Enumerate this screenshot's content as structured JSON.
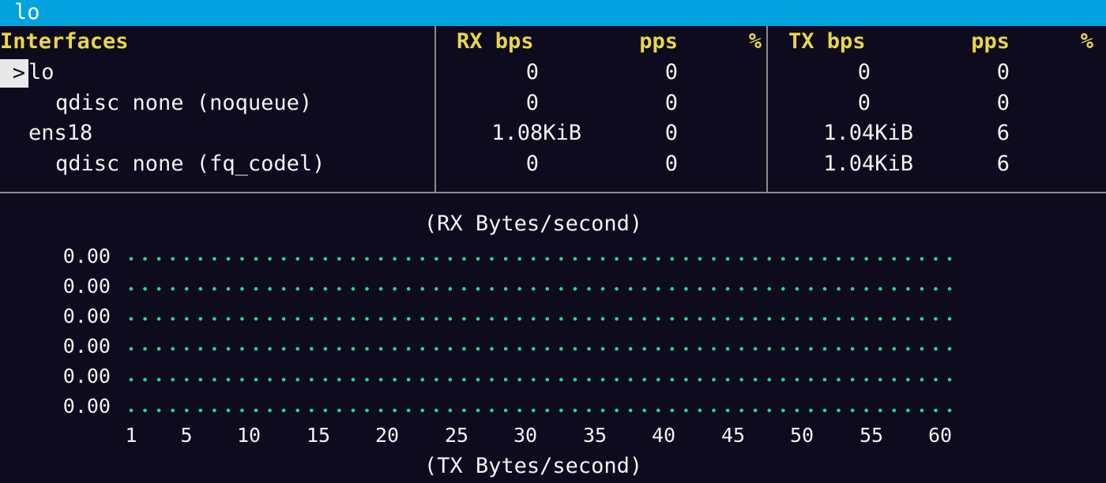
{
  "window": {
    "title": "lo"
  },
  "table": {
    "headers": {
      "interfaces": "Interfaces",
      "rx_bps": "RX bps",
      "rx_pps": "pps",
      "rx_pct": "%",
      "tx_bps": "TX bps",
      "tx_pps": "pps",
      "tx_pct": "%"
    },
    "cursor_glyph": ">",
    "rows": [
      {
        "name": "lo",
        "rx_bps": "0",
        "rx_pps": "0",
        "tx_bps": "0",
        "tx_pps": "0"
      },
      {
        "name": "qdisc none (noqueue)",
        "rx_bps": "0",
        "rx_pps": "0",
        "tx_bps": "0",
        "tx_pps": "0"
      },
      {
        "name": "ens18",
        "rx_bps": "1.08KiB",
        "rx_pps": "0",
        "tx_bps": "1.04KiB",
        "tx_pps": "6"
      },
      {
        "name": "qdisc none (fq_codel)",
        "rx_bps": "0",
        "rx_pps": "0",
        "tx_bps": "1.04KiB",
        "tx_pps": "6"
      }
    ]
  },
  "graph": {
    "top_label": "(RX Bytes/second)",
    "bottom_label": "(TX Bytes/second)",
    "y_labels": [
      "0.00",
      "0.00",
      "0.00",
      "0.00",
      "0.00",
      "0.00"
    ],
    "x_ticks": [
      "1",
      "5",
      "10",
      "15",
      "20",
      "25",
      "30",
      "35",
      "40",
      "45",
      "50",
      "55",
      "60"
    ],
    "dot_color": "#1fdc8e",
    "dots_per_row": 60
  }
}
